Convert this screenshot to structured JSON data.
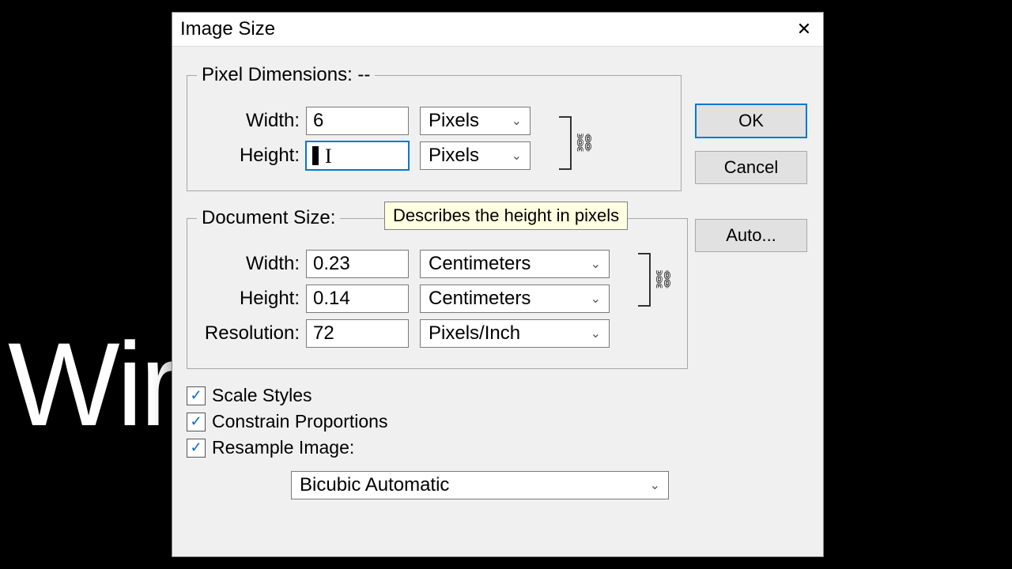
{
  "background_text": "Wir",
  "dialog": {
    "title": "Image Size",
    "close_glyph": "✕"
  },
  "pixel_dimensions": {
    "legend": "Pixel Dimensions:   --",
    "width_label": "Width:",
    "width_value": "6",
    "width_unit": "Pixels",
    "height_label": "Height:",
    "height_value": "",
    "height_unit": "Pixels",
    "link_icon": "⛓"
  },
  "document_size": {
    "legend": "Document Size:",
    "width_label": "Width:",
    "width_value": "0.23",
    "width_unit": "Centimeters",
    "height_label": "Height:",
    "height_value": "0.14",
    "height_unit": "Centimeters",
    "resolution_label": "Resolution:",
    "resolution_value": "72",
    "resolution_unit": "Pixels/Inch",
    "link_icon": "⛓"
  },
  "checkboxes": {
    "scale_styles": "Scale Styles",
    "constrain": "Constrain Proportions",
    "resample": "Resample Image:"
  },
  "resample_method": "Bicubic Automatic",
  "buttons": {
    "ok": "OK",
    "cancel": "Cancel",
    "auto": "Auto..."
  },
  "tooltip": "Describes the height in pixels",
  "checkmark": "✓",
  "chevron": "⌄"
}
